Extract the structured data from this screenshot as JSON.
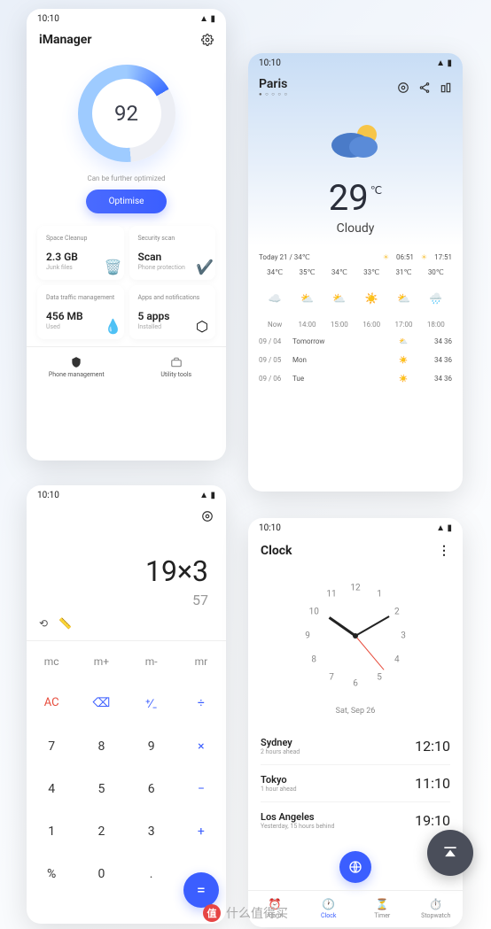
{
  "status": {
    "time": "10:10",
    "signal": "▲ ▮"
  },
  "imanager": {
    "title": "iManager",
    "score": "92",
    "caption": "Can be further optimized",
    "optimise": "Optimise",
    "cards": [
      {
        "title": "Space Cleanup",
        "value": "2.3 GB",
        "sub": "Junk files"
      },
      {
        "title": "Security scan",
        "value": "Scan",
        "sub": "Phone protection"
      },
      {
        "title": "Data traffic management",
        "value": "456 MB",
        "sub": "Used"
      },
      {
        "title": "Apps and notifications",
        "value": "5 apps",
        "sub": "Installed"
      }
    ],
    "tabs": [
      "Phone management",
      "Utility tools"
    ]
  },
  "weather": {
    "city": "Paris",
    "temp": "29",
    "unit": "℃",
    "condition": "Cloudy",
    "today_label": "Today  21 / 34℃",
    "sunrise": "06:51",
    "sunset": "17:51",
    "hours": [
      {
        "temp": "34℃",
        "icon": "☁️",
        "time": "Now"
      },
      {
        "temp": "35℃",
        "icon": "⛅",
        "time": "14:00"
      },
      {
        "temp": "34℃",
        "icon": "⛅",
        "time": "15:00"
      },
      {
        "temp": "33℃",
        "icon": "☀️",
        "time": "16:00"
      },
      {
        "temp": "31℃",
        "icon": "⛅",
        "time": "17:00"
      },
      {
        "temp": "30℃",
        "icon": "🌧️",
        "time": "18:00"
      }
    ],
    "days": [
      {
        "date": "09 / 04",
        "name": "Tomorrow",
        "icon": "⛅",
        "range": "34  36"
      },
      {
        "date": "09 / 05",
        "name": "Mon",
        "icon": "☀️",
        "range": "34  36"
      },
      {
        "date": "09 / 06",
        "name": "Tue",
        "icon": "☀️",
        "range": "34  36"
      }
    ]
  },
  "calculator": {
    "expr": "19×3",
    "result": "57",
    "keys": [
      [
        "mc",
        "m+",
        "m-",
        "mr"
      ],
      [
        "AC",
        "⌫",
        "⁺∕₋",
        "÷"
      ],
      [
        "7",
        "8",
        "9",
        "×"
      ],
      [
        "4",
        "5",
        "6",
        "−"
      ],
      [
        "1",
        "2",
        "3",
        "+"
      ],
      [
        "%",
        "0",
        ".",
        "="
      ]
    ]
  },
  "clock": {
    "title": "Clock",
    "date": "Sat, Sep 26",
    "numbers": [
      "12",
      "1",
      "2",
      "3",
      "4",
      "5",
      "6",
      "7",
      "8",
      "9",
      "10",
      "11"
    ],
    "cities": [
      {
        "city": "Sydney",
        "off": "2 hours ahead",
        "time": "12:10"
      },
      {
        "city": "Tokyo",
        "off": "1 hour ahead",
        "time": "11:10"
      },
      {
        "city": "Los Angeles",
        "off": "Yesterday, 15 hours behind",
        "time": "19:10"
      }
    ],
    "tabs": [
      "Alarm",
      "Clock",
      "Timer",
      "Stopwatch"
    ]
  },
  "watermark": "什么值得买",
  "watermark_logo": "值"
}
